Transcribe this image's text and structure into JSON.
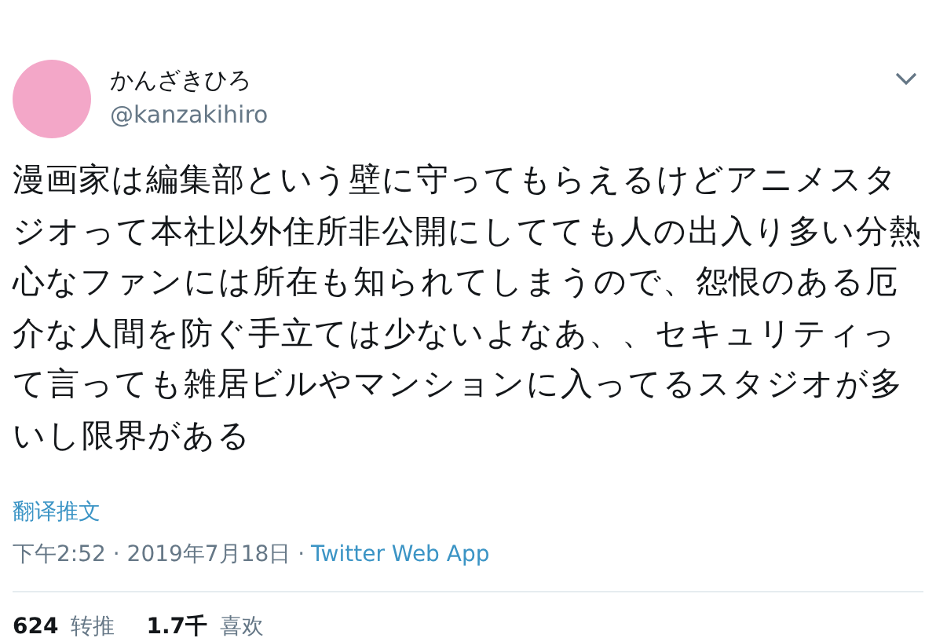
{
  "author": {
    "name": "かんざきひろ",
    "handle": "@kanzakihiro"
  },
  "body": "漫画家は編集部という壁に守ってもらえるけどアニメスタジオって本社以外住所非公開にしてても人の出入り多い分熱心なファンには所在も知られてしまうので、怨恨のある厄介な人間を防ぐ手立ては少ないよなあ、、セキュリティって言っても雑居ビルやマンションに入ってるスタジオが多いし限界がある",
  "translate_link": "翻译推文",
  "timestamp": "下午2:52 · 2019年7月18日 ·",
  "source": "Twitter Web App",
  "stats": [
    {
      "count": "624",
      "label": "转推"
    },
    {
      "count": "1.7千",
      "label": "喜欢"
    }
  ]
}
